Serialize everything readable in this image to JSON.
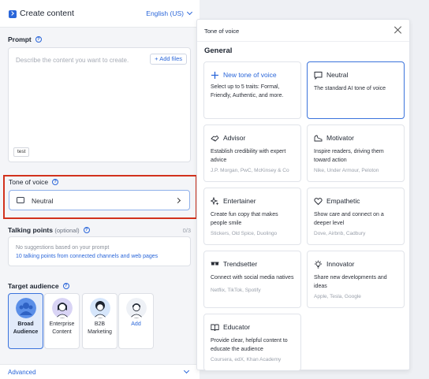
{
  "header": {
    "title": "Create content",
    "language": "English (US)"
  },
  "prompt": {
    "label": "Prompt",
    "placeholder": "Describe the content you want to create.",
    "add_files": "+ Add files",
    "attachment": "test"
  },
  "tone": {
    "label": "Tone of voice",
    "value": "Neutral"
  },
  "talking_points": {
    "label": "Talking points",
    "optional": "(optional)",
    "count": "0/3",
    "line1": "No suggestions based on your prompt",
    "line2": "10 talking points from connected channels and web pages"
  },
  "audience": {
    "label": "Target audience",
    "items": [
      {
        "label": "Broad Audience",
        "selected": true
      },
      {
        "label": "Enterprise Content"
      },
      {
        "label": "B2B Marketing"
      },
      {
        "label": "Add"
      }
    ]
  },
  "advanced": {
    "label": "Advanced"
  },
  "panel": {
    "title": "Tone of voice",
    "section": "General",
    "cards": [
      {
        "title": "New tone of voice",
        "desc": "Select up to 5 traits: Formal, Friendly, Authentic, and more.",
        "examples": "",
        "icon": "plus-icon"
      },
      {
        "title": "Neutral",
        "desc": "The standard AI tone of voice",
        "examples": "",
        "icon": "chat-bubble-icon",
        "selected": true
      },
      {
        "title": "Advisor",
        "desc": "Establish credibility with expert advice",
        "examples": "J.P. Morgan, PwC, McKinsey & Co",
        "icon": "handshake-icon"
      },
      {
        "title": "Motivator",
        "desc": "Inspire readers, driving them toward action",
        "examples": "Nike, Under Armour, Peloton",
        "icon": "running-shoe-icon"
      },
      {
        "title": "Entertainer",
        "desc": "Create fun copy that makes people smile",
        "examples": "Stickers, Old Spice, Duolingo",
        "icon": "sparkle-icon"
      },
      {
        "title": "Empathetic",
        "desc": "Show care and connect on a deeper level",
        "examples": "Dove, Airbnb, Cadbury",
        "icon": "heart-icon"
      },
      {
        "title": "Trendsetter",
        "desc": "Connect with social media natives",
        "examples": "Netflix, TikTok, Spotify",
        "icon": "glasses-icon"
      },
      {
        "title": "Innovator",
        "desc": "Share new developments and ideas",
        "examples": "Apple, Tesla, Google",
        "icon": "lightbulb-icon"
      },
      {
        "title": "Educator",
        "desc": "Provide clear, helpful content to educate the audience",
        "examples": "Coursera, edX, Khan Academy",
        "icon": "book-icon"
      }
    ]
  },
  "colors": {
    "accent": "#2a66d9",
    "highlight": "#d2321d",
    "selected_bg": "#e2ebfa"
  }
}
